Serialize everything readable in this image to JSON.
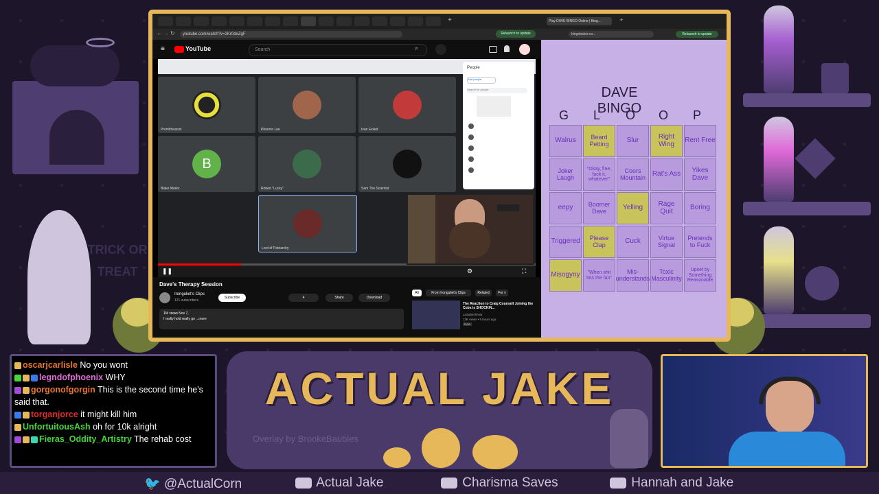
{
  "browser_left": {
    "url": "youtube.com/watch?v=2Kr0deZgF",
    "search_placeholder": "Search",
    "yt_logo": "YouTube",
    "participants": [
      "Promitheanist",
      "Phoenix Lee",
      "Ivan Exiled",
      "Blake Marks",
      "Robert \"Lucky\"",
      "Sam The Scientist",
      "Lord of Patriarchy"
    ],
    "avatar_letter": "B",
    "video_title": "Dave's Therapy Session",
    "channel_name": "Ironguliet's Clips",
    "channel_subs": "121 subscribers",
    "subscribe_label": "Subscribe",
    "like_count": "4",
    "share_label": "Share",
    "download_label": "Download",
    "desc_line1": "1M views  Nov 7,",
    "desc_line2": "I really hold really go ...more",
    "chip_all": "All",
    "chip_from": "From Ironguliet's Clips",
    "chip_related": "Related",
    "chip_for": "For y",
    "rec_title": "The Reaction to Craig Counsell Joining the Cubs is SHOCKIN...",
    "rec_channel": "LaSaberShow",
    "rec_meta": "13K views • 6 hours ago",
    "rec_badge": "New",
    "people_title": "People",
    "people_add": "Add people",
    "people_search": "Search for people"
  },
  "browser_right": {
    "tab_title": "Play DAVE BINGO Online | Bing...",
    "url": "bingobaker.co...",
    "update_label": "Relaunch to update",
    "bingo_title": "DAVE BINGO",
    "columns": [
      "G",
      "L",
      "O",
      "O",
      "P"
    ],
    "cells": [
      [
        "Walrus",
        "Beard Petting",
        "Slur",
        "Right Wing",
        "Rent Free"
      ],
      [
        "Joker Laugh",
        "\"Okay, fine, fuck it, whatever\"",
        "Coors Mountain",
        "Rat's Ass",
        "Yikes Dave"
      ],
      [
        "eepy",
        "Boomer Dave",
        "Yelling",
        "Rage Quit",
        "Boring"
      ],
      [
        "Triggered",
        "Please Clap",
        "Cuck",
        "Virtue Signal",
        "Pretends to Fuck"
      ],
      [
        "Misogyny",
        "\"When shit hits the fan\"",
        "Mis-understands",
        "Toxic Masculinity",
        "Upset by Something Reasonable"
      ]
    ],
    "marked": [
      [
        false,
        true,
        false,
        true,
        false
      ],
      [
        false,
        false,
        false,
        false,
        false
      ],
      [
        false,
        false,
        true,
        false,
        false
      ],
      [
        false,
        true,
        false,
        false,
        false
      ],
      [
        true,
        false,
        false,
        false,
        false
      ]
    ]
  },
  "chat": [
    {
      "user": "oscarjcarlisle",
      "color": "#e8742c",
      "text": "No you wont"
    },
    {
      "user": "legndofphoenix",
      "color": "#e06ad9",
      "text": "WHY"
    },
    {
      "user": "gorgonofgorgin",
      "color": "#e8742c",
      "text": "This is the second time he's said that."
    },
    {
      "user": "torganjorce",
      "color": "#e02a2a",
      "text": "it might kill him"
    },
    {
      "user": "UnfortuitousAsh",
      "color": "#45d63a",
      "text": "oh for 10k alright"
    },
    {
      "user": "Fieras_Oddity_Artistry",
      "color": "#45d63a",
      "text": "The rehab cost"
    }
  ],
  "stream_title": "ACTUAL JAKE",
  "overlay_credit": "Overlay by BrookeBaubles",
  "decor_text": "TRICK OR TREAT",
  "socials": [
    {
      "icon": "twitter-icon",
      "label": "@ActualCorn"
    },
    {
      "icon": "youtube-icon",
      "label": "Actual Jake"
    },
    {
      "icon": "youtube-icon",
      "label": "Charisma Saves"
    },
    {
      "icon": "youtube-icon",
      "label": "Hannah and Jake"
    }
  ],
  "colors": {
    "frame": "#e7b85a",
    "purple": "#5c4a80",
    "bingo_bg": "#c7b0e6"
  }
}
